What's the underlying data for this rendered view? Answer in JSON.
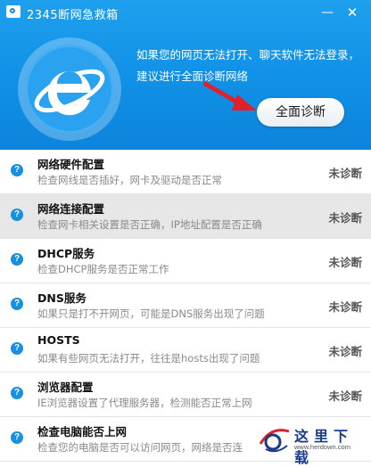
{
  "window": {
    "title": "2345断网急救箱",
    "minimize_label": "—",
    "close_label": "✕"
  },
  "header": {
    "message_line1": "如果您的网页无法打开、聊天软件无法登录，",
    "message_line2": "建议进行全面诊断网络",
    "diagnose_button": "全面诊断"
  },
  "colors": {
    "header_blue": "#1090e6",
    "arrow_red": "#e0202a",
    "icon_blue": "#1a8fe0"
  },
  "items": [
    {
      "title": "网络硬件配置",
      "desc": "检查网线是否插好，网卡及驱动是否正常",
      "status": "未诊断",
      "icon": "help-icon"
    },
    {
      "title": "网络连接配置",
      "desc": "检查网卡相关设置是否正确，IP地址配置是否正确",
      "status": "未诊断",
      "icon": "help-icon"
    },
    {
      "title": "DHCP服务",
      "desc": "检查DHCP服务是否正常工作",
      "status": "未诊断",
      "icon": "help-icon"
    },
    {
      "title": "DNS服务",
      "desc": "如果只是打不开网页，可能是DNS服务出现了问题",
      "status": "未诊断",
      "icon": "help-icon"
    },
    {
      "title": "HOSTS",
      "desc": "如果有些网页无法打开，往往是hosts出现了问题",
      "status": "未诊断",
      "icon": "help-icon"
    },
    {
      "title": "浏览器配置",
      "desc": "IE浏览器设置了代理服务器，检测能否正常上网",
      "status": "未诊断",
      "icon": "help-icon"
    },
    {
      "title": "检查电脑能否上网",
      "desc": "检查您的电脑是否可以访问网页，网络是否连",
      "status": "",
      "icon": "help-icon"
    }
  ],
  "watermark": {
    "text": "这里下载",
    "url": "www.herdown.com"
  }
}
